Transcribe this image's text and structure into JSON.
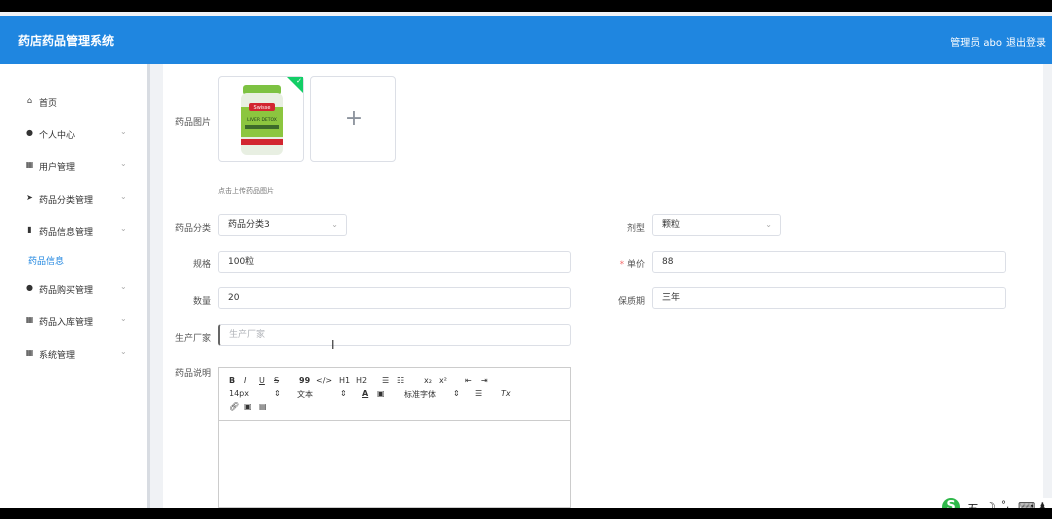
{
  "header": {
    "title": "药店药品管理系统",
    "user": "管理员 abo",
    "logout": "退出登录"
  },
  "sidebar": {
    "items": [
      {
        "label": "首页",
        "icon": "⌂",
        "chevron": ""
      },
      {
        "label": "个人中心",
        "icon": "●",
        "chevron": "⌄"
      },
      {
        "label": "用户管理",
        "icon": "▦",
        "chevron": "⌄"
      },
      {
        "label": "药品分类管理",
        "icon": "➤",
        "chevron": "⌄"
      },
      {
        "label": "药品信息管理",
        "icon": "▮",
        "chevron": "⌄"
      },
      {
        "label": "药品购买管理",
        "icon": "●",
        "chevron": "⌄"
      },
      {
        "label": "药品入库管理",
        "icon": "▦",
        "chevron": "⌄"
      },
      {
        "label": "系统管理",
        "icon": "▦",
        "chevron": "⌄"
      }
    ],
    "submenu_active": "药品信息"
  },
  "form": {
    "image_label": "药品图片",
    "image_product": {
      "brand": "Swisse",
      "name": "LIVER DETOX"
    },
    "upload_plus": "+",
    "upload_hint": "点击上传药品图片",
    "category_label": "药品分类",
    "category_value": "药品分类3",
    "dosage_label": "剂型",
    "dosage_value": "颗粒",
    "spec_label": "规格",
    "spec_value": "100粒",
    "price_required": "*",
    "price_label": "单价",
    "price_value": "88",
    "qty_label": "数量",
    "qty_value": "20",
    "shelf_label": "保质期",
    "shelf_value": "三年",
    "maker_label": "生产厂家",
    "maker_placeholder": "生产厂家",
    "desc_label": "药品说明"
  },
  "editor": {
    "row1": [
      "B",
      "I",
      "U",
      "S",
      "99",
      "</>",
      "H1",
      "H2",
      "☰",
      "☷",
      "x₂",
      "x²",
      "⇤",
      "⇥"
    ],
    "font_size": "14px",
    "text_style": "文本",
    "font_family": "标准字体",
    "clear": "Tx"
  },
  "ime": {
    "logo": "S",
    "mode": "五",
    "moon": "☽",
    "punct": "°,",
    "keyboard": "⌨",
    "person": "♟"
  },
  "colors": {
    "header_bg": "#1f86e0",
    "active": "#1f86e0",
    "required": "#f56c6c",
    "upload_check": "#13ce66"
  }
}
